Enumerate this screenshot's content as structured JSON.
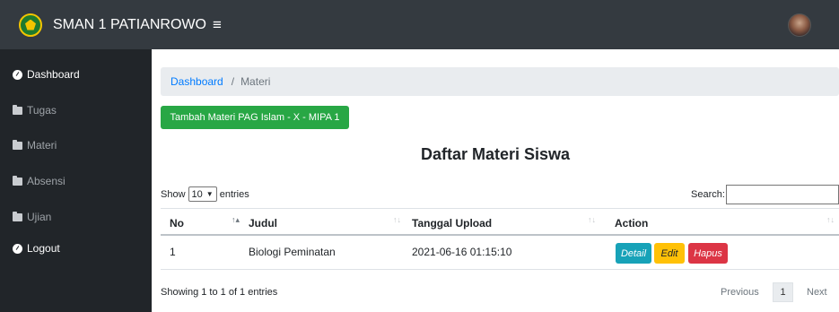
{
  "header": {
    "brand": "SMAN 1 PATIANROWO",
    "menu_icon": "hamburger-icon",
    "logo_icon": "school-logo",
    "avatar_icon": "user-avatar"
  },
  "sidebar": {
    "items": [
      {
        "label": "Dashboard",
        "icon": "tachometer-icon"
      },
      {
        "label": "Tugas",
        "icon": "folder-icon"
      },
      {
        "label": "Materi",
        "icon": "folder-icon"
      },
      {
        "label": "Absensi",
        "icon": "folder-icon"
      },
      {
        "label": "Ujian",
        "icon": "folder-icon"
      },
      {
        "label": "Logout",
        "icon": "tachometer-icon"
      }
    ]
  },
  "breadcrumb": {
    "home": "Dashboard",
    "separator": "/",
    "current": "Materi"
  },
  "add_button": "Tambah Materi PAG Islam - X - MIPA 1",
  "page_title": "Daftar Materi Siswa",
  "table_controls": {
    "show_label": "Show",
    "entries_value": "10",
    "entries_label": "entries",
    "search_label": "Search:",
    "search_value": ""
  },
  "table": {
    "columns": [
      "No",
      "Judul",
      "Tanggal Upload",
      "Action"
    ],
    "rows": [
      {
        "no": "1",
        "judul": "Biologi Peminatan",
        "tanggal": "2021-06-16 01:15:10"
      }
    ],
    "actions": {
      "detail": "Detail",
      "edit": "Edit",
      "hapus": "Hapus"
    }
  },
  "footer": {
    "info": "Showing 1 to 1 of 1 entries",
    "previous": "Previous",
    "page": "1",
    "next": "Next"
  },
  "colors": {
    "topbar": "#343a40",
    "sidebar": "#212529",
    "primary_link": "#007bff",
    "success": "#28a745",
    "info": "#17a2b8",
    "warning": "#ffc107",
    "danger": "#dc3545"
  }
}
